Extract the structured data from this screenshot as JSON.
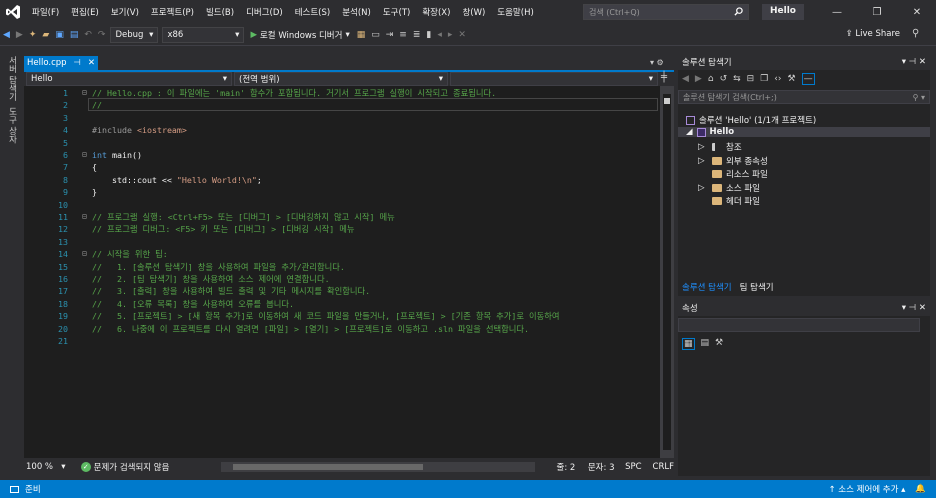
{
  "menu": [
    "파일(F)",
    "편집(E)",
    "보기(V)",
    "프로젝트(P)",
    "빌드(B)",
    "디버그(D)",
    "테스트(S)",
    "분석(N)",
    "도구(T)",
    "확장(X)",
    "창(W)",
    "도움말(H)"
  ],
  "search": {
    "placeholder": "검색 (Ctrl+Q)"
  },
  "solution_name": "Hello",
  "toolbar": {
    "config": "Debug",
    "platform": "x86",
    "run_label": "로컬 Windows 디버거",
    "live_share": "Live Share"
  },
  "left_tabs": [
    "서버 탐색기",
    "도구 상자"
  ],
  "editor": {
    "tab_label": "Hello.cpp",
    "scope_left": "Hello",
    "scope_mid": "(전역 범위)",
    "lines": [
      {
        "n": "1",
        "t": "// Hello.cpp : 이 파일에는 'main' 함수가 포함됩니다. 거기서 프로그램 실행이 시작되고 종료됩니다.",
        "c": "cm",
        "f": "⊟"
      },
      {
        "n": "2",
        "t": "//",
        "c": "cm",
        "f": ""
      },
      {
        "n": "3",
        "t": "",
        "c": "",
        "f": ""
      },
      {
        "n": "4",
        "t": "#include <iostream>",
        "c": "inc",
        "f": ""
      },
      {
        "n": "5",
        "t": "",
        "c": "",
        "f": ""
      },
      {
        "n": "6",
        "t": "int main()",
        "c": "fn",
        "f": "⊟"
      },
      {
        "n": "7",
        "t": "{",
        "c": "",
        "f": ""
      },
      {
        "n": "8",
        "t": "    std::cout << \"Hello World!\\n\";",
        "c": "out",
        "f": ""
      },
      {
        "n": "9",
        "t": "}",
        "c": "",
        "f": ""
      },
      {
        "n": "10",
        "t": "",
        "c": "",
        "f": ""
      },
      {
        "n": "11",
        "t": "// 프로그램 실행: <Ctrl+F5> 또는 [디버그] > [디버깅하지 않고 시작] 메뉴",
        "c": "cm",
        "f": "⊟"
      },
      {
        "n": "12",
        "t": "// 프로그램 디버그: <F5> 키 또는 [디버그] > [디버깅 시작] 메뉴",
        "c": "cm",
        "f": ""
      },
      {
        "n": "13",
        "t": "",
        "c": "",
        "f": ""
      },
      {
        "n": "14",
        "t": "// 시작을 위한 팁:",
        "c": "cm",
        "f": "⊟"
      },
      {
        "n": "15",
        "t": "//   1. [솔루션 탐색기] 창을 사용하여 파일을 추가/관리합니다.",
        "c": "cm",
        "f": ""
      },
      {
        "n": "16",
        "t": "//   2. [팀 탐색기] 창을 사용하여 소스 제어에 연결합니다.",
        "c": "cm",
        "f": ""
      },
      {
        "n": "17",
        "t": "//   3. [출력] 창을 사용하여 빌드 출력 및 기타 메시지를 확인합니다.",
        "c": "cm",
        "f": ""
      },
      {
        "n": "18",
        "t": "//   4. [오류 목록] 창을 사용하여 오류를 봅니다.",
        "c": "cm",
        "f": ""
      },
      {
        "n": "19",
        "t": "//   5. [프로젝트] > [새 항목 추가]로 이동하여 새 코드 파일을 만들거나, [프로젝트] > [기존 항목 추가]로 이동하여",
        "c": "cm",
        "f": ""
      },
      {
        "n": "20",
        "t": "//   6. 나중에 이 프로젝트를 다시 열려면 [파일] > [열기] > [프로젝트]로 이동하고 .sln 파일을 선택합니다.",
        "c": "cm",
        "f": ""
      },
      {
        "n": "21",
        "t": "",
        "c": "",
        "f": ""
      }
    ]
  },
  "edit_status": {
    "zoom": "100 %",
    "issues": "문제가 검색되지 않음",
    "line": "줄: 2",
    "col": "문자: 3",
    "spc": "SPC",
    "crlf": "CRLF"
  },
  "solution_explorer": {
    "title": "솔루션 탐색기",
    "search_placeholder": "솔루션 탐색기 검색(Ctrl+;)",
    "root": "솔루션 'Hello' (1/1개 프로젝트)",
    "project": "Hello",
    "items": [
      "참조",
      "외부 종속성",
      "리소스 파일",
      "소스 파일",
      "헤더 파일"
    ],
    "tabs": [
      "솔루션 탐색기",
      "팀 탐색기"
    ]
  },
  "properties": {
    "title": "속성"
  },
  "status": {
    "left": "준비",
    "right": "소스 제어에 추가"
  },
  "colors": {
    "accent": "#007acc",
    "comment": "#57a64a",
    "keyword": "#569cd6",
    "string": "#d69d85"
  }
}
